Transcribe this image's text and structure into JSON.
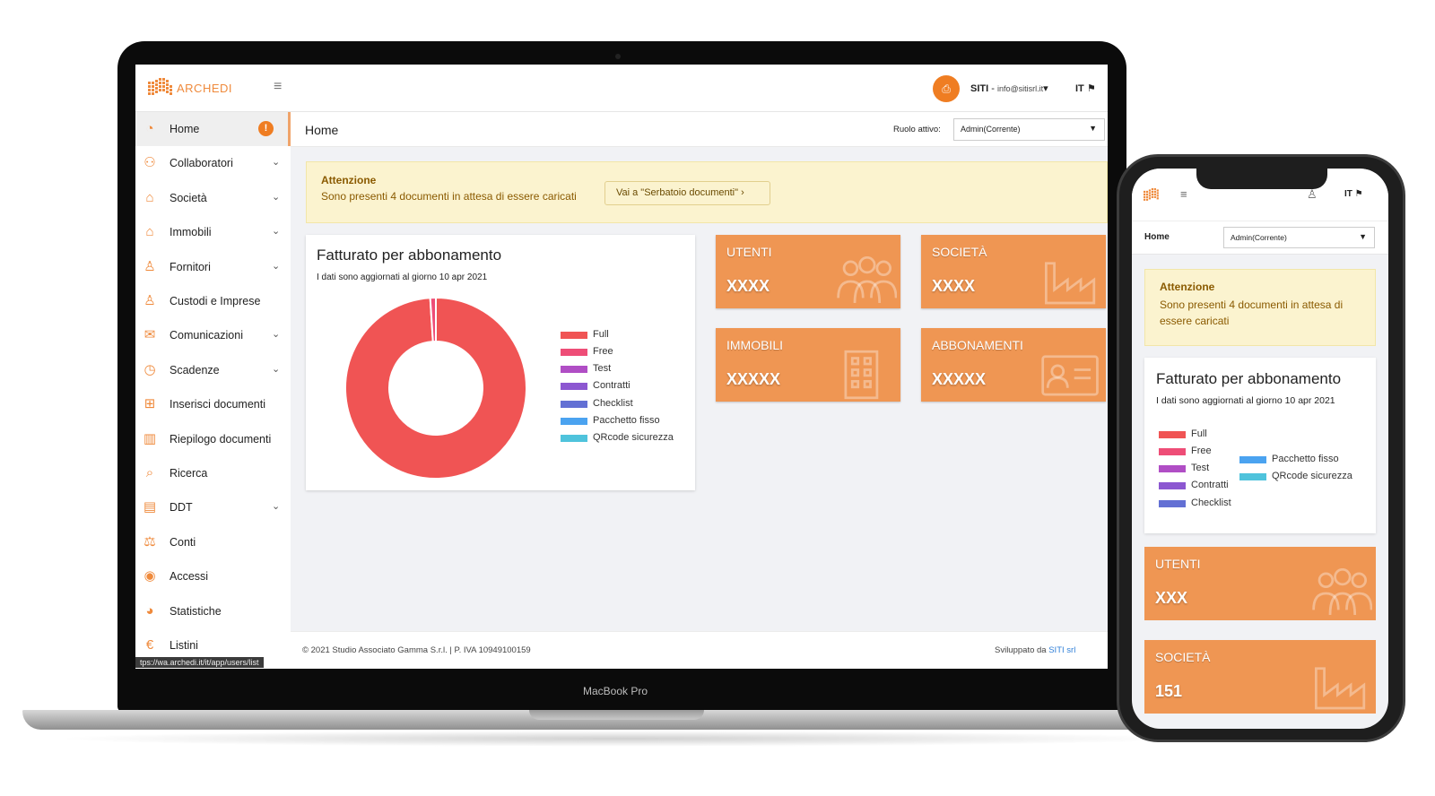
{
  "device_label": "MacBook Pro",
  "app": {
    "logo_text": "ARCHEDI",
    "user_initial_icon": "print-icon",
    "user_name": "SITI",
    "user_email": "info@sitisrl.it",
    "language": "IT"
  },
  "sidebar": {
    "items": [
      {
        "label": "Home",
        "icon": "dashboard-icon",
        "chevron": false,
        "alert": "!"
      },
      {
        "label": "Collaboratori",
        "icon": "people-icon",
        "chevron": true
      },
      {
        "label": "Società",
        "icon": "factory-icon",
        "chevron": true
      },
      {
        "label": "Immobili",
        "icon": "house-icon",
        "chevron": true
      },
      {
        "label": "Fornitori",
        "icon": "worker-icon",
        "chevron": true
      },
      {
        "label": "Custodi e Imprese",
        "icon": "person-key-icon",
        "chevron": false
      },
      {
        "label": "Comunicazioni",
        "icon": "mail-icon",
        "chevron": true
      },
      {
        "label": "Scadenze",
        "icon": "clock-icon",
        "chevron": true
      },
      {
        "label": "Inserisci documenti",
        "icon": "file-add-icon",
        "chevron": false
      },
      {
        "label": "Riepilogo documenti",
        "icon": "bar-chart-icon",
        "chevron": false
      },
      {
        "label": "Ricerca",
        "icon": "search-icon",
        "chevron": false
      },
      {
        "label": "DDT",
        "icon": "clipboard-icon",
        "chevron": true
      },
      {
        "label": "Conti",
        "icon": "scale-icon",
        "chevron": false
      },
      {
        "label": "Accessi",
        "icon": "eye-icon",
        "chevron": false
      },
      {
        "label": "Statistiche",
        "icon": "pie-icon",
        "chevron": false
      },
      {
        "label": "Listini",
        "icon": "euro-icon",
        "chevron": false
      }
    ],
    "url_tooltip": "tps://wa.archedi.it/it/app/users/list"
  },
  "header": {
    "title": "Home",
    "role_label": "Ruolo attivo:",
    "role_value": "Admin(Corrente)"
  },
  "alert": {
    "title": "Attenzione",
    "text": "Sono presenti 4 documenti in attesa di essere caricati",
    "button": "Vai a \"Serbatoio documenti\" ›"
  },
  "chart_card": {
    "title": "Fatturato per abbonamento",
    "subtitle": "I dati sono aggiornati al giorno 10 apr 2021"
  },
  "chart_data": {
    "type": "pie",
    "categories": [
      "Full",
      "Free",
      "Test",
      "Contratti",
      "Checklist",
      "Pacchetto fisso",
      "QRcode sicurezza"
    ],
    "values": [
      99,
      1,
      0,
      0,
      0,
      0,
      0
    ],
    "colors": [
      "#f05454",
      "#ee4d77",
      "#b04ec5",
      "#8c57d1",
      "#6370d4",
      "#4ba3f0",
      "#4fc3dc"
    ],
    "donut": true
  },
  "stats": [
    {
      "title": "UTENTI",
      "value": "XXXX",
      "icon": "people-icon"
    },
    {
      "title": "SOCIETÀ",
      "value": "XXXX",
      "icon": "factory-icon"
    },
    {
      "title": "IMMOBILI",
      "value": "XXXXX",
      "icon": "building-icon"
    },
    {
      "title": "ABBONAMENTI",
      "value": "XXXXX",
      "icon": "id-card-icon"
    }
  ],
  "footer": {
    "copyright": "© 2021 Studio Associato Gamma S.r.l. | P. IVA 10949100159",
    "developed_by": "Sviluppato da",
    "developer": "SITI srl"
  },
  "phone": {
    "language": "IT",
    "title": "Home",
    "role_value": "Admin(Corrente)",
    "alert_title": "Attenzione",
    "alert_text": "Sono presenti 4 documenti in attesa di essere caricati",
    "card_title": "Fatturato per abbonamento",
    "card_subtitle": "I dati sono aggiornati al giorno 10 apr 2021",
    "stats": [
      {
        "title": "UTENTI",
        "value": "XXX"
      },
      {
        "title": "SOCIETÀ",
        "value": "151"
      }
    ]
  }
}
